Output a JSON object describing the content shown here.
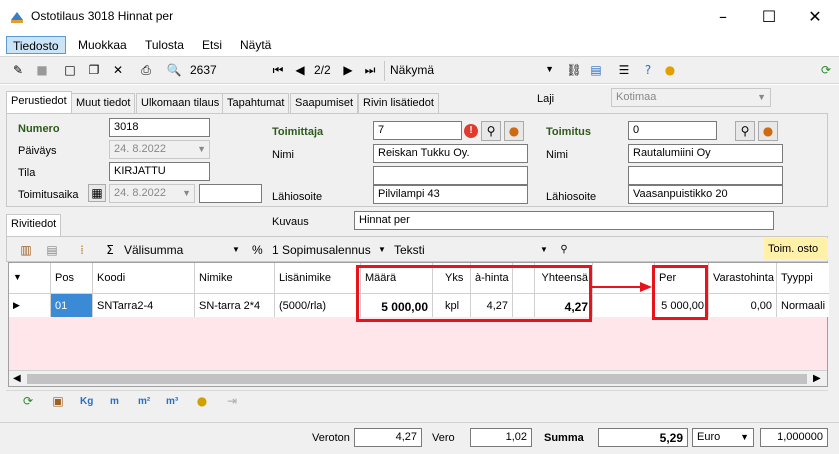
{
  "window": {
    "title": "Ostotilaus 3018 Hinnat per"
  },
  "menu": [
    "Tiedosto",
    "Muokkaa",
    "Tulosta",
    "Etsi",
    "Näytä"
  ],
  "toolbar": {
    "record_number": "2637",
    "page_indicator": "2/2",
    "view_label": "Näkymä"
  },
  "tabs": [
    "Perustiedot",
    "Muut tiedot",
    "Ulkomaan tilaus",
    "Tapahtumat",
    "Saapumiset",
    "Rivin lisätiedot"
  ],
  "laji": {
    "label": "Laji",
    "value": "Kotimaa"
  },
  "left": {
    "numero_label": "Numero",
    "numero": "3018",
    "paivays_label": "Päiväys",
    "paivays": "24. 8.2022",
    "tila_label": "Tila",
    "tila": "KIRJATTU",
    "toimitusaika_label": "Toimitusaika",
    "toimitusaika": "24. 8.2022"
  },
  "supplier": {
    "label": "Toimittaja",
    "number": "7",
    "nimi_label": "Nimi",
    "nimi": "Reiskan Tukku Oy.",
    "lahiosoite_label": "Lähiosoite",
    "lahiosoite": "Pilvilampi 43"
  },
  "delivery": {
    "label": "Toimitus",
    "number": "0",
    "nimi_label": "Nimi",
    "nimi": "Rautalumiini Oy",
    "lahiosoite_label": "Lähiosoite",
    "lahiosoite": "Vaasanpuistikko 20"
  },
  "kuvaus": {
    "label": "Kuvaus",
    "value": "Hinnat per"
  },
  "row_tab": "Rivitiedot",
  "grid_toolbar": {
    "valisumma": "Välisumma",
    "percent": "%",
    "sopimus": "1 Sopimusalennus",
    "teksti": "Teksti",
    "toim_osto": "Toim. osto"
  },
  "grid": {
    "headers": {
      "pos": "Pos",
      "koodi": "Koodi",
      "nimike": "Nimike",
      "lisanimike": "Lisänimike",
      "maara": "Määrä",
      "yks": "Yks",
      "ahinta": "à-hinta",
      "yhteensa": "Yhteensä",
      "per": "Per",
      "varastohinta": "Varastohinta",
      "tyyppi": "Tyyppi"
    },
    "rows": [
      {
        "pos": "01",
        "koodi": "SNTarra2-4",
        "nimike": "SN-tarra 2*4",
        "lisanimike": "(5000/rla)",
        "maara": "5 000,00",
        "yks": "kpl",
        "ahinta": "4,27",
        "yhteensa": "4,27",
        "per": "5 000,00",
        "varastohinta": "0,00",
        "tyyppi": "Normaali"
      }
    ]
  },
  "bottom_icons": {
    "kg": "Kg",
    "m": "m",
    "m2": "m²",
    "m3": "m³"
  },
  "footer": {
    "veroton_label": "Veroton",
    "veroton": "4,27",
    "vero_label": "Vero",
    "vero": "1,02",
    "summa_label": "Summa",
    "summa": "5,29",
    "currency": "Euro",
    "rate": "1,000000"
  },
  "colors": {
    "highlight": "#e8141c",
    "grid_bg": "#ffe6ea",
    "label_green": "#2e5a1c"
  }
}
